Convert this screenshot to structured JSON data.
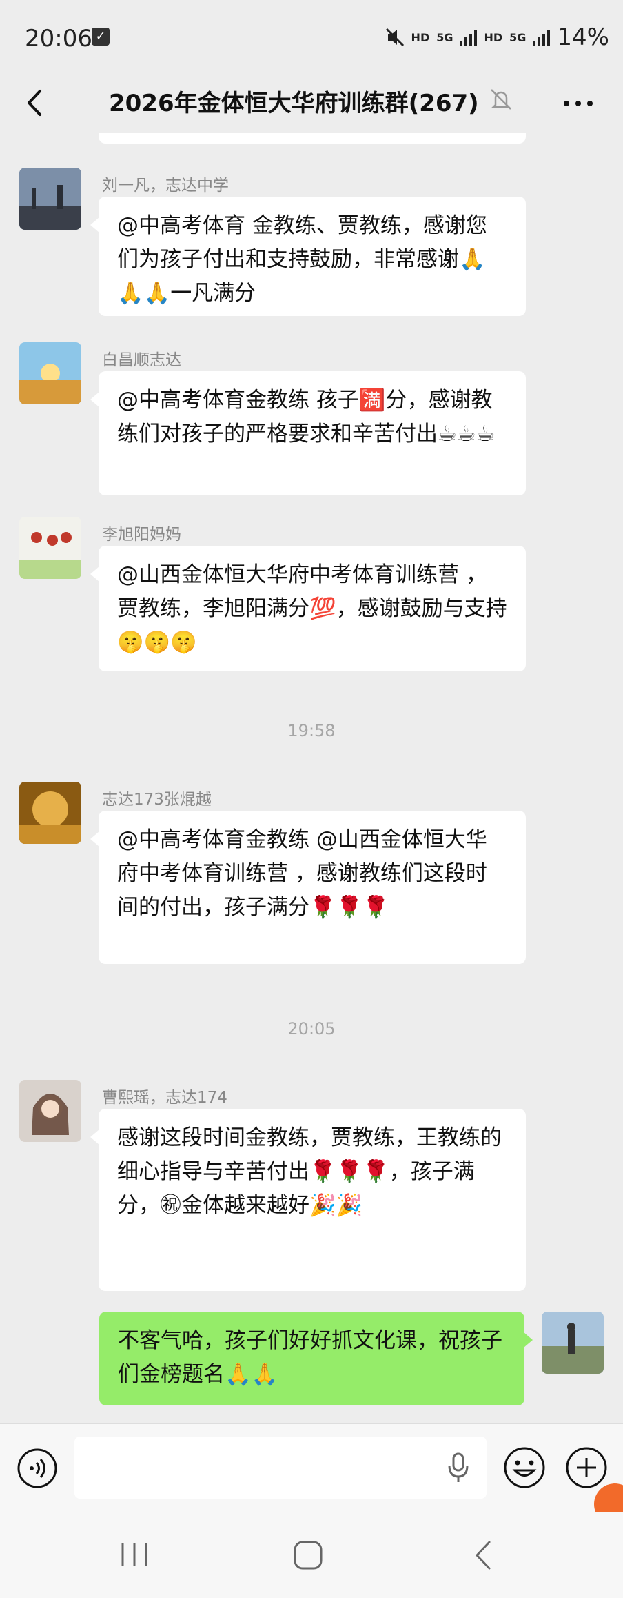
{
  "status_bar": {
    "time": "20:06",
    "network_label_1": "HD",
    "network_label_2": "5G",
    "network_label_3": "HD",
    "network_label_4": "5G",
    "battery": "14%"
  },
  "header": {
    "title": "2026年金体恒大华府训练群(267)",
    "back_icon": "back-chevron-icon",
    "mute_icon": "muted-bell-icon",
    "more_icon": "more-dots-icon"
  },
  "messages": [
    {
      "sender": "刘一凡，志达中学",
      "text": "@中高考体育  金教练、贾教练，感谢您们为孩子付出和支持鼓励，非常感谢🙏🙏🙏一凡满分"
    },
    {
      "sender": "白昌顺志达",
      "text": "@中高考体育金教练  孩子🈵分，感谢教练们对孩子的严格要求和辛苦付出☕☕☕"
    },
    {
      "sender": "李旭阳妈妈",
      "text": "@山西金体恒大华府中考体育训练营 ，贾教练，李旭阳满分💯，感谢鼓励与支持🤫🤫🤫"
    },
    {
      "sender": "志达173张焜越",
      "text": "@中高考体育金教练  @山西金体恒大华府中考体育训练营 ，感谢教练们这段时间的付出，孩子满分🌹🌹🌹"
    },
    {
      "sender": "曹熙瑶，志达174",
      "text": "感谢这段时间金教练，贾教练，王教练的细心指导与辛苦付出🌹🌹🌹，孩子满分，㊗金体越来越好🎉🎉"
    },
    {
      "sender": "",
      "text": "不客气哈，孩子们好好抓文化课，祝孩子们金榜题名🙏🙏"
    }
  ],
  "time_dividers": [
    "19:58",
    "20:05"
  ],
  "input_bar": {
    "voice_icon": "voice-input-icon",
    "input_value": "",
    "mic_icon": "microphone-icon",
    "emoji_icon": "emoji-icon",
    "plus_icon": "plus-icon"
  },
  "nav_bar": {
    "recent_icon": "recent-apps-icon",
    "home_icon": "home-icon",
    "back_icon": "nav-back-icon"
  },
  "colors": {
    "background": "#EDEDED",
    "incoming_bubble": "#FFFFFF",
    "outgoing_bubble": "#95EC69",
    "secondary_text": "#888888",
    "timestamp_text": "#A5A5A5",
    "badge": "#F26A2A"
  }
}
